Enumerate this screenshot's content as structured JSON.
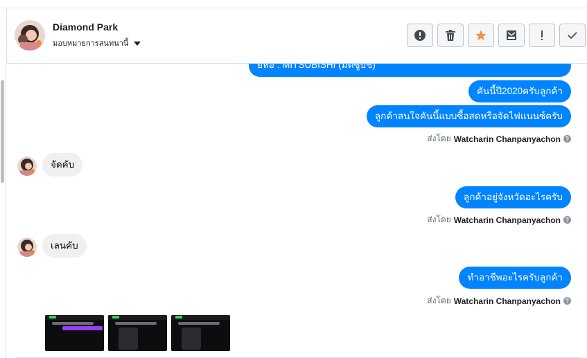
{
  "header": {
    "contact_name": "Diamond Park",
    "assign_label": "มอบหมายการสนทนานี้"
  },
  "actions": [
    {
      "name": "spam-button",
      "icon": "alert-circle-icon"
    },
    {
      "name": "delete-button",
      "icon": "trash-icon"
    },
    {
      "name": "star-button",
      "icon": "star-icon",
      "color": "#f7923b"
    },
    {
      "name": "archive-button",
      "icon": "mail-archive-icon"
    },
    {
      "name": "follow-up-button",
      "icon": "exclamation-icon"
    },
    {
      "name": "done-button",
      "icon": "check-icon"
    }
  ],
  "messages": {
    "m0": "ยี่ห้อ : MITSUBISHI (มิตซูบิชิ)",
    "m1": "คันนี้ปี2020ครับลูกค้า",
    "m2": "ลูกค้าสนใจคันนี้แบบซื้อสดหรือจัดไฟแนนซ์ครับ",
    "in1": "จัดคับ",
    "m3": "ลูกค้าอยู่จังหวัดอะไรครับ",
    "in2": "เลนคับ",
    "m4": "ทำอาชีพอะไรครับลูกค้า"
  },
  "sent_by": {
    "prefix": "ส่งโดย",
    "agent": "Watcharin Chanpanyachon",
    "help": "?"
  },
  "colors": {
    "outgoing_bubble": "#0084ff",
    "incoming_bubble": "#f0f0f0"
  }
}
